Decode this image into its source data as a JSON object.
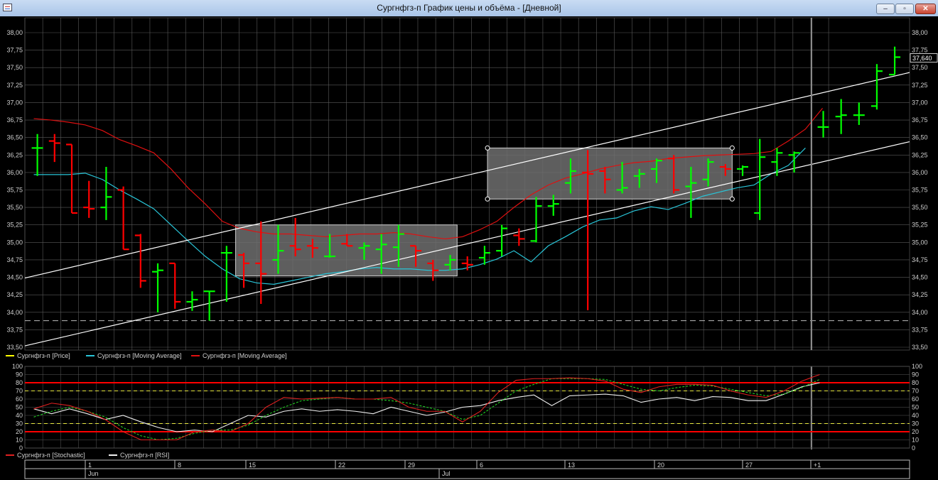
{
  "window": {
    "title": "Сургнфгз-п График цены и объёма - [Дневной]",
    "minimize_glyph": "‒",
    "maximize_glyph": "▫",
    "close_glyph": "✕"
  },
  "icons": [
    "app-icon",
    "minimize-icon",
    "maximize-icon",
    "close-icon"
  ],
  "colors": {
    "background": "#000000",
    "grid": "#5a5a5a",
    "price_up": "#00ff00",
    "price_down": "#ff0000",
    "ma_fast": "#29c5d8",
    "ma_slow": "#e01010",
    "trendline": "#ffffff",
    "box_fill": "#6e6e6e",
    "stochastic": "#e02020",
    "stochastic_signal": "#22cc22",
    "rsi": "#f0f0f0",
    "level_strong": "#ff0000",
    "level_weak": "#e8e840"
  },
  "chart_data": [
    {
      "type": "candlestick",
      "price_label": "37,640",
      "legend": [
        {
          "label": "Сургнфгз-п [Price]",
          "color": "#ffff00"
        },
        {
          "label": "Сургнфгз-п [Moving Average]",
          "color": "#29c5d8"
        },
        {
          "label": "Сургнфгз-п [Moving Average]",
          "color": "#e01010"
        }
      ],
      "ylim": [
        33.5,
        38.0
      ],
      "yticks": [
        "33,50",
        "33,75",
        "34,00",
        "34,25",
        "34,50",
        "34,75",
        "35,00",
        "35,25",
        "35,50",
        "35,75",
        "36,00",
        "36,25",
        "36,50",
        "36,75",
        "37,00",
        "37,25",
        "37,50",
        "37,75",
        "38,00"
      ],
      "x_range": [
        -0.5,
        44.5
      ],
      "grid": true,
      "reference_line": 33.88,
      "cursor_index": 43.5,
      "bars": [
        {
          "i": 0,
          "o": 36.35,
          "h": 36.55,
          "l": 35.95,
          "c": 36.35
        },
        {
          "i": 1,
          "o": 36.45,
          "h": 36.55,
          "l": 36.15,
          "c": 36.42
        },
        {
          "i": 2,
          "o": 36.4,
          "h": 36.4,
          "l": 35.42,
          "c": 35.42
        },
        {
          "i": 3,
          "o": 35.5,
          "h": 35.88,
          "l": 35.35,
          "c": 35.48
        },
        {
          "i": 4,
          "o": 35.5,
          "h": 36.08,
          "l": 35.32,
          "c": 35.65
        },
        {
          "i": 5,
          "o": 35.75,
          "h": 35.8,
          "l": 34.9,
          "c": 34.9
        },
        {
          "i": 6,
          "o": 35.1,
          "h": 35.12,
          "l": 34.35,
          "c": 34.45
        },
        {
          "i": 7,
          "o": 34.58,
          "h": 34.7,
          "l": 34.0,
          "c": 34.6
        },
        {
          "i": 8,
          "o": 34.7,
          "h": 34.7,
          "l": 34.05,
          "c": 34.15
        },
        {
          "i": 9,
          "o": 34.15,
          "h": 34.3,
          "l": 34.02,
          "c": 34.18
        },
        {
          "i": 10,
          "o": 34.3,
          "h": 34.3,
          "l": 33.88,
          "c": 34.3
        },
        {
          "i": 11,
          "o": 34.85,
          "h": 34.95,
          "l": 34.15,
          "c": 34.85
        },
        {
          "i": 12,
          "o": 34.82,
          "h": 34.85,
          "l": 34.35,
          "c": 34.7
        },
        {
          "i": 13,
          "o": 34.7,
          "h": 35.3,
          "l": 34.12,
          "c": 34.55
        },
        {
          "i": 14,
          "o": 34.75,
          "h": 35.25,
          "l": 34.55,
          "c": 34.88
        },
        {
          "i": 15,
          "o": 34.95,
          "h": 35.35,
          "l": 34.8,
          "c": 34.9
        },
        {
          "i": 16,
          "o": 34.95,
          "h": 35.05,
          "l": 34.78,
          "c": 34.92
        },
        {
          "i": 17,
          "o": 34.8,
          "h": 35.12,
          "l": 34.78,
          "c": 34.8
        },
        {
          "i": 18,
          "o": 34.98,
          "h": 35.12,
          "l": 34.95,
          "c": 34.95
        },
        {
          "i": 19,
          "o": 34.92,
          "h": 35.0,
          "l": 34.75,
          "c": 34.95
        },
        {
          "i": 20,
          "o": 34.9,
          "h": 35.12,
          "l": 34.55,
          "c": 34.97
        },
        {
          "i": 21,
          "o": 34.93,
          "h": 35.25,
          "l": 34.65,
          "c": 35.12
        },
        {
          "i": 22,
          "o": 34.95,
          "h": 34.95,
          "l": 34.65,
          "c": 34.88
        },
        {
          "i": 23,
          "o": 34.7,
          "h": 34.75,
          "l": 34.45,
          "c": 34.6
        },
        {
          "i": 24,
          "o": 34.68,
          "h": 34.82,
          "l": 34.6,
          "c": 34.75
        },
        {
          "i": 25,
          "o": 34.7,
          "h": 34.8,
          "l": 34.6,
          "c": 34.68
        },
        {
          "i": 26,
          "o": 34.78,
          "h": 34.95,
          "l": 34.68,
          "c": 34.85
        },
        {
          "i": 27,
          "o": 34.88,
          "h": 35.25,
          "l": 34.8,
          "c": 35.2
        },
        {
          "i": 28,
          "o": 35.1,
          "h": 35.2,
          "l": 34.95,
          "c": 35.05
        },
        {
          "i": 29,
          "o": 35.02,
          "h": 35.65,
          "l": 35.0,
          "c": 35.52
        },
        {
          "i": 30,
          "o": 35.52,
          "h": 35.68,
          "l": 35.38,
          "c": 35.55
        },
        {
          "i": 31,
          "o": 35.85,
          "h": 36.2,
          "l": 35.7,
          "c": 36.02
        },
        {
          "i": 32,
          "o": 36.0,
          "h": 36.32,
          "l": 34.03,
          "c": 35.98
        },
        {
          "i": 33,
          "o": 36.02,
          "h": 36.08,
          "l": 35.7,
          "c": 35.9
        },
        {
          "i": 34,
          "o": 35.75,
          "h": 36.15,
          "l": 35.7,
          "c": 35.78
        },
        {
          "i": 35,
          "o": 35.95,
          "h": 36.05,
          "l": 35.78,
          "c": 35.98
        },
        {
          "i": 36,
          "o": 36.05,
          "h": 36.2,
          "l": 35.85,
          "c": 36.17
        },
        {
          "i": 37,
          "o": 36.2,
          "h": 36.25,
          "l": 35.7,
          "c": 35.75
        },
        {
          "i": 38,
          "o": 35.8,
          "h": 36.08,
          "l": 35.35,
          "c": 35.85
        },
        {
          "i": 39,
          "o": 35.9,
          "h": 36.2,
          "l": 35.8,
          "c": 36.15
        },
        {
          "i": 40,
          "o": 36.08,
          "h": 36.12,
          "l": 35.95,
          "c": 36.05
        },
        {
          "i": 41,
          "o": 36.05,
          "h": 36.1,
          "l": 35.95,
          "c": 36.08
        },
        {
          "i": 42,
          "o": 35.42,
          "h": 36.48,
          "l": 35.32,
          "c": 36.22
        },
        {
          "i": 43,
          "o": 36.15,
          "h": 36.35,
          "l": 35.95,
          "c": 36.28
        },
        {
          "i": 44,
          "o": 36.25,
          "h": 36.3,
          "l": 36.0,
          "c": 36.28
        }
      ],
      "ma_fast": [],
      "ma_slow": []
    },
    {
      "type": "line",
      "legend": [
        {
          "label": "Сургнфгз-п [Stochastic]",
          "color": "#e02020"
        },
        {
          "label": "Сургнфгз-п [RSI]",
          "color": "#f0f0f0"
        }
      ],
      "ylim": [
        0,
        100
      ],
      "yticks": [
        "0",
        "10",
        "20",
        "30",
        "40",
        "50",
        "60",
        "70",
        "80",
        "90",
        "100"
      ],
      "levels": [
        {
          "value": 80,
          "style": "strong"
        },
        {
          "value": 20,
          "style": "strong"
        },
        {
          "value": 70,
          "style": "weak"
        },
        {
          "value": 30,
          "style": "weak"
        }
      ]
    }
  ],
  "x_axis": {
    "days": [
      "1",
      "8",
      "15",
      "22",
      "29",
      "6",
      "13",
      "20",
      "27",
      "+1"
    ],
    "months": [
      "Jun",
      "Jul"
    ]
  }
}
